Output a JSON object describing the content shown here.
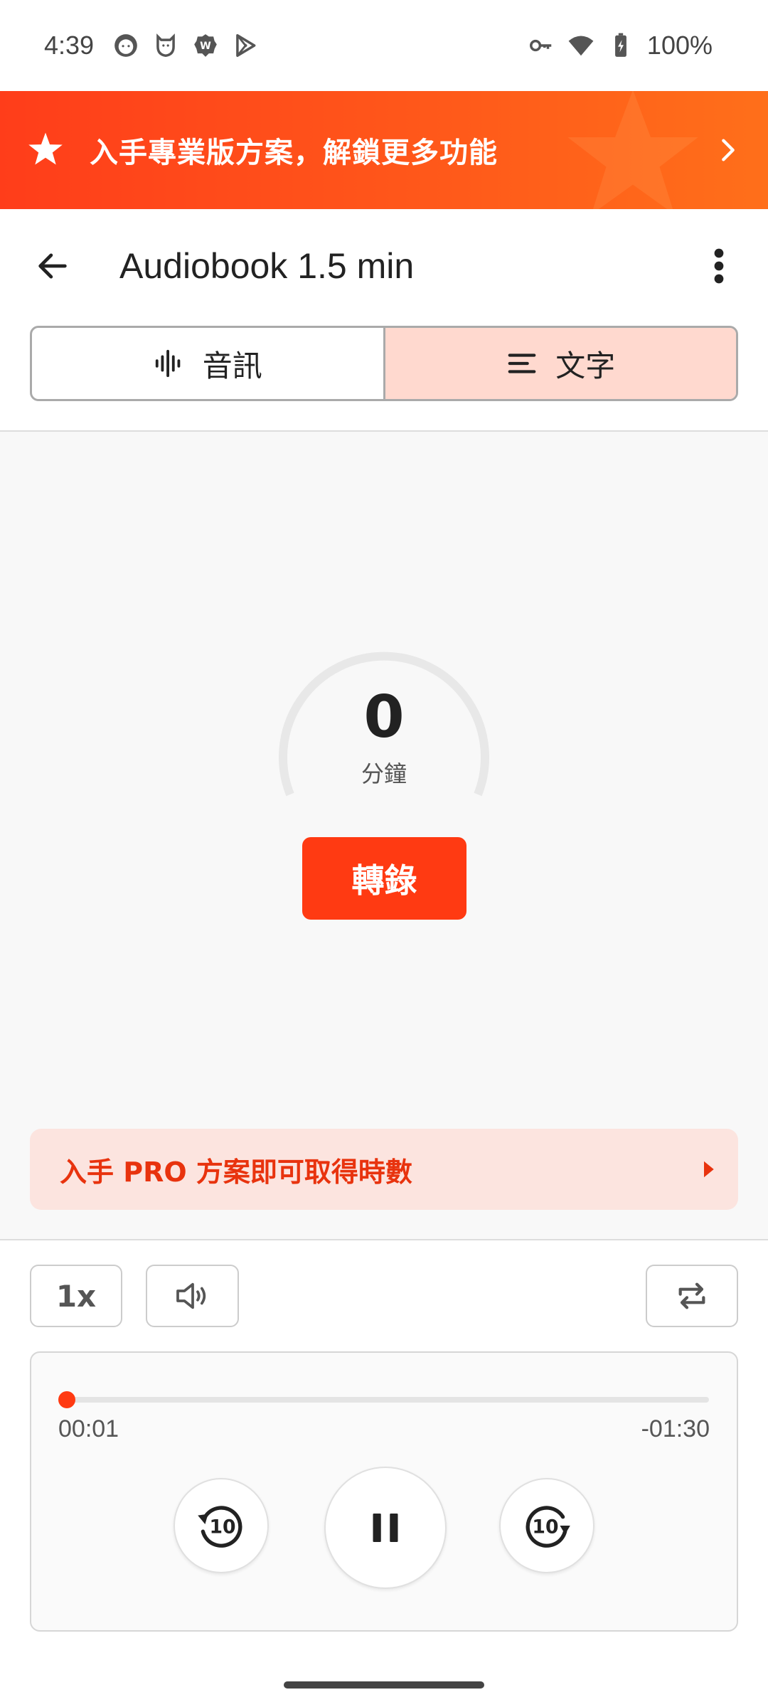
{
  "status_bar": {
    "time": "4:39",
    "battery": "100%",
    "icons": [
      "cat-face-icon",
      "shield-cat-icon",
      "status-badge-icon",
      "play-store-icon",
      "vpn-key-icon",
      "wifi-icon",
      "battery-charging-icon"
    ]
  },
  "promo": {
    "text": "入手專業版方案，解鎖更多功能",
    "color_start": "#ff3d1a",
    "color_end": "#ff6f1a"
  },
  "app_bar": {
    "title": "Audiobook 1.5 min"
  },
  "tabs": [
    {
      "label": "音訊",
      "icon": "waveform-icon",
      "active": false
    },
    {
      "label": "文字",
      "icon": "text-lines-icon",
      "active": true
    }
  ],
  "transcript": {
    "minutes_value": "0",
    "minutes_unit": "分鐘",
    "transcribe_label": "轉錄",
    "pro_hours_text": "入手 PRO 方案即可取得時數"
  },
  "controls": {
    "speed_label": "1x",
    "volume_icon": "volume-icon",
    "repeat_icon": "repeat-icon"
  },
  "player": {
    "elapsed": "00:01",
    "remaining": "-01:30",
    "progress_fraction": 0.011,
    "rewind_label": "10",
    "forward_label": "10",
    "accent_color": "#ff3a12"
  }
}
